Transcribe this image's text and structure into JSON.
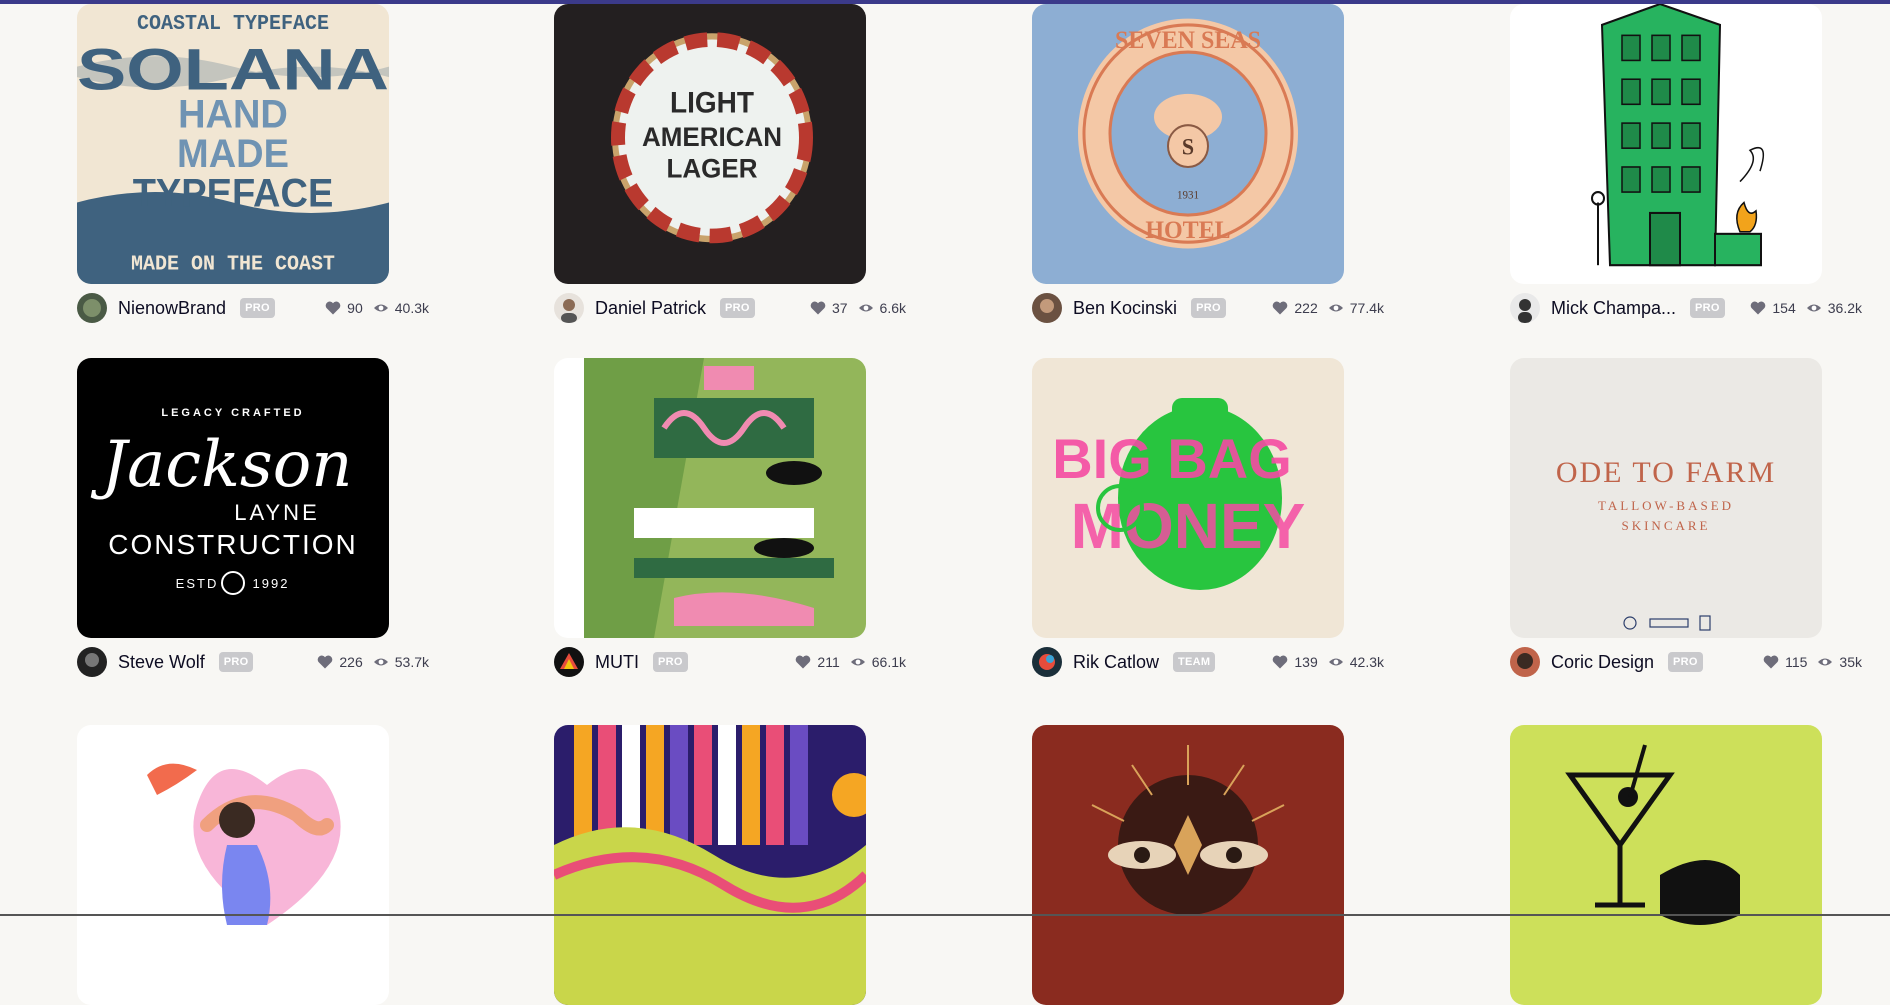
{
  "cards": [
    {
      "author": "NienowBrand",
      "badge": "PRO",
      "likes": "90",
      "views": "40.3k",
      "art": {
        "line1": "COASTAL TYPEFACE",
        "line2": "SOLANA",
        "line3": "HAND",
        "line4": "MADE",
        "line5": "TYPEFACE",
        "line6": "MADE ON THE COAST"
      }
    },
    {
      "author": "Daniel Patrick",
      "badge": "PRO",
      "likes": "37",
      "views": "6.6k",
      "art": {
        "line1": "LIGHT",
        "line2": "AMERICAN",
        "line3": "LAGER"
      }
    },
    {
      "author": "Ben Kocinski",
      "badge": "PRO",
      "likes": "222",
      "views": "77.4k",
      "art": {
        "line1": "SEVEN SEAS",
        "line2": "HOTEL",
        "line3": "S",
        "line4": "1931"
      }
    },
    {
      "author": "Mick Champa...",
      "badge": "PRO",
      "likes": "154",
      "views": "36.2k",
      "art": {}
    },
    {
      "author": "Steve Wolf",
      "badge": "PRO",
      "likes": "226",
      "views": "53.7k",
      "art": {
        "line1": "LEGACY CRAFTED",
        "line2": "Jackson",
        "line3": "LAYNE",
        "line4": "CONSTRUCTION",
        "line5": "ESTD",
        "line6": "1992"
      }
    },
    {
      "author": "MUTI",
      "badge": "PRO",
      "likes": "211",
      "views": "66.1k",
      "art": {}
    },
    {
      "author": "Rik Catlow",
      "badge": "TEAM",
      "likes": "139",
      "views": "42.3k",
      "art": {
        "line1": "BIG BAG",
        "line2": "MONEY"
      }
    },
    {
      "author": "Coric Design",
      "badge": "PRO",
      "likes": "115",
      "views": "35k",
      "art": {
        "line1": "ODE TO FARM",
        "line2": "TALLOW-BASED",
        "line3": "SKINCARE"
      }
    },
    {
      "art": {}
    },
    {
      "art": {}
    },
    {
      "art": {}
    },
    {
      "art": {}
    }
  ],
  "colors": {
    "page_bg": "#f8f7f4",
    "badge_bg": "#c9c9cc",
    "text": "#0d0c22",
    "topbar": "#3b3a8a"
  },
  "icons": {
    "likes": "heart-icon",
    "views": "eye-icon"
  }
}
